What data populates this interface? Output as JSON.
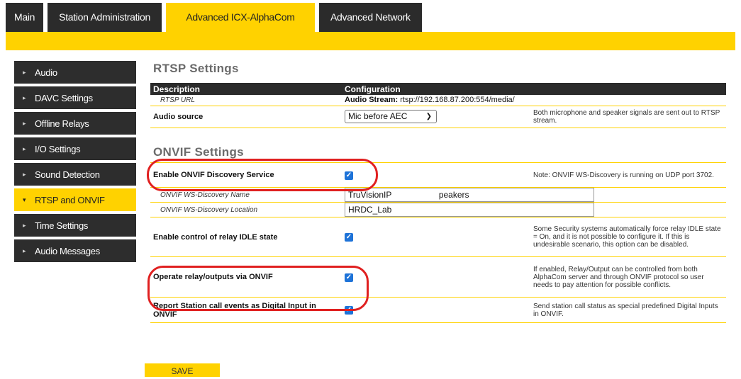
{
  "tabs": [
    {
      "label": "Main"
    },
    {
      "label": "Station Administration"
    },
    {
      "label": "Advanced ICX-AlphaCom"
    },
    {
      "label": "Advanced Network"
    }
  ],
  "sidebar": {
    "items": [
      {
        "label": "Audio"
      },
      {
        "label": "DAVC Settings"
      },
      {
        "label": "Offline Relays"
      },
      {
        "label": "I/O Settings"
      },
      {
        "label": "Sound Detection"
      },
      {
        "label": "RTSP and ONVIF",
        "active": true
      },
      {
        "label": "Time Settings"
      },
      {
        "label": "Audio Messages"
      }
    ]
  },
  "rtsp": {
    "title": "RTSP Settings",
    "col_description": "Description",
    "col_configuration": "Configuration",
    "url_label": "RTSP URL",
    "url_prefix": "Audio Stream:",
    "url_value": "rtsp://192.168.87.200:554/media/",
    "audio_source_label": "Audio source",
    "audio_source_value": "Mic before AEC",
    "audio_source_note": "Both microphone and speaker signals are sent out to RTSP stream."
  },
  "onvif": {
    "title": "ONVIF Settings",
    "discovery_label": "Enable ONVIF Discovery Service",
    "discovery_checked": true,
    "discovery_note": "Note: ONVIF WS-Discovery is running on UDP port 3702.",
    "name_label": "ONVIF WS-Discovery Name",
    "name_value": "TruVisionIP                    peakers",
    "location_label": "ONVIF WS-Discovery Location",
    "location_value": "HRDC_Lab",
    "relay_idle_label": "Enable control of relay IDLE state",
    "relay_idle_checked": true,
    "relay_idle_note": "Some Security systems automatically force relay IDLE state = On, and it is not possible to configure it. If this is undesirable scenario, this option can be disabled.",
    "operate_relay_label": "Operate relay/outputs via ONVIF",
    "operate_relay_checked": true,
    "operate_relay_note": "If enabled, Relay/Output can be controlled from both AlphaCom server and through ONVIF protocol so user needs to pay attention for possible conflicts.",
    "report_label": "Report Station call events as Digital Input in ONVIF",
    "report_checked": true,
    "report_note": "Send station call status as special predefined Digital Inputs in ONVIF."
  },
  "save_label": "SAVE",
  "icons": {
    "chevron": "chevron-right-icon",
    "check": "check-icon",
    "dropdown": "chevron-down-icon"
  },
  "colors": {
    "accent": "#ffd200",
    "dark": "#2b2b2b",
    "highlight": "#e02020",
    "checkbox": "#1e73d8"
  }
}
